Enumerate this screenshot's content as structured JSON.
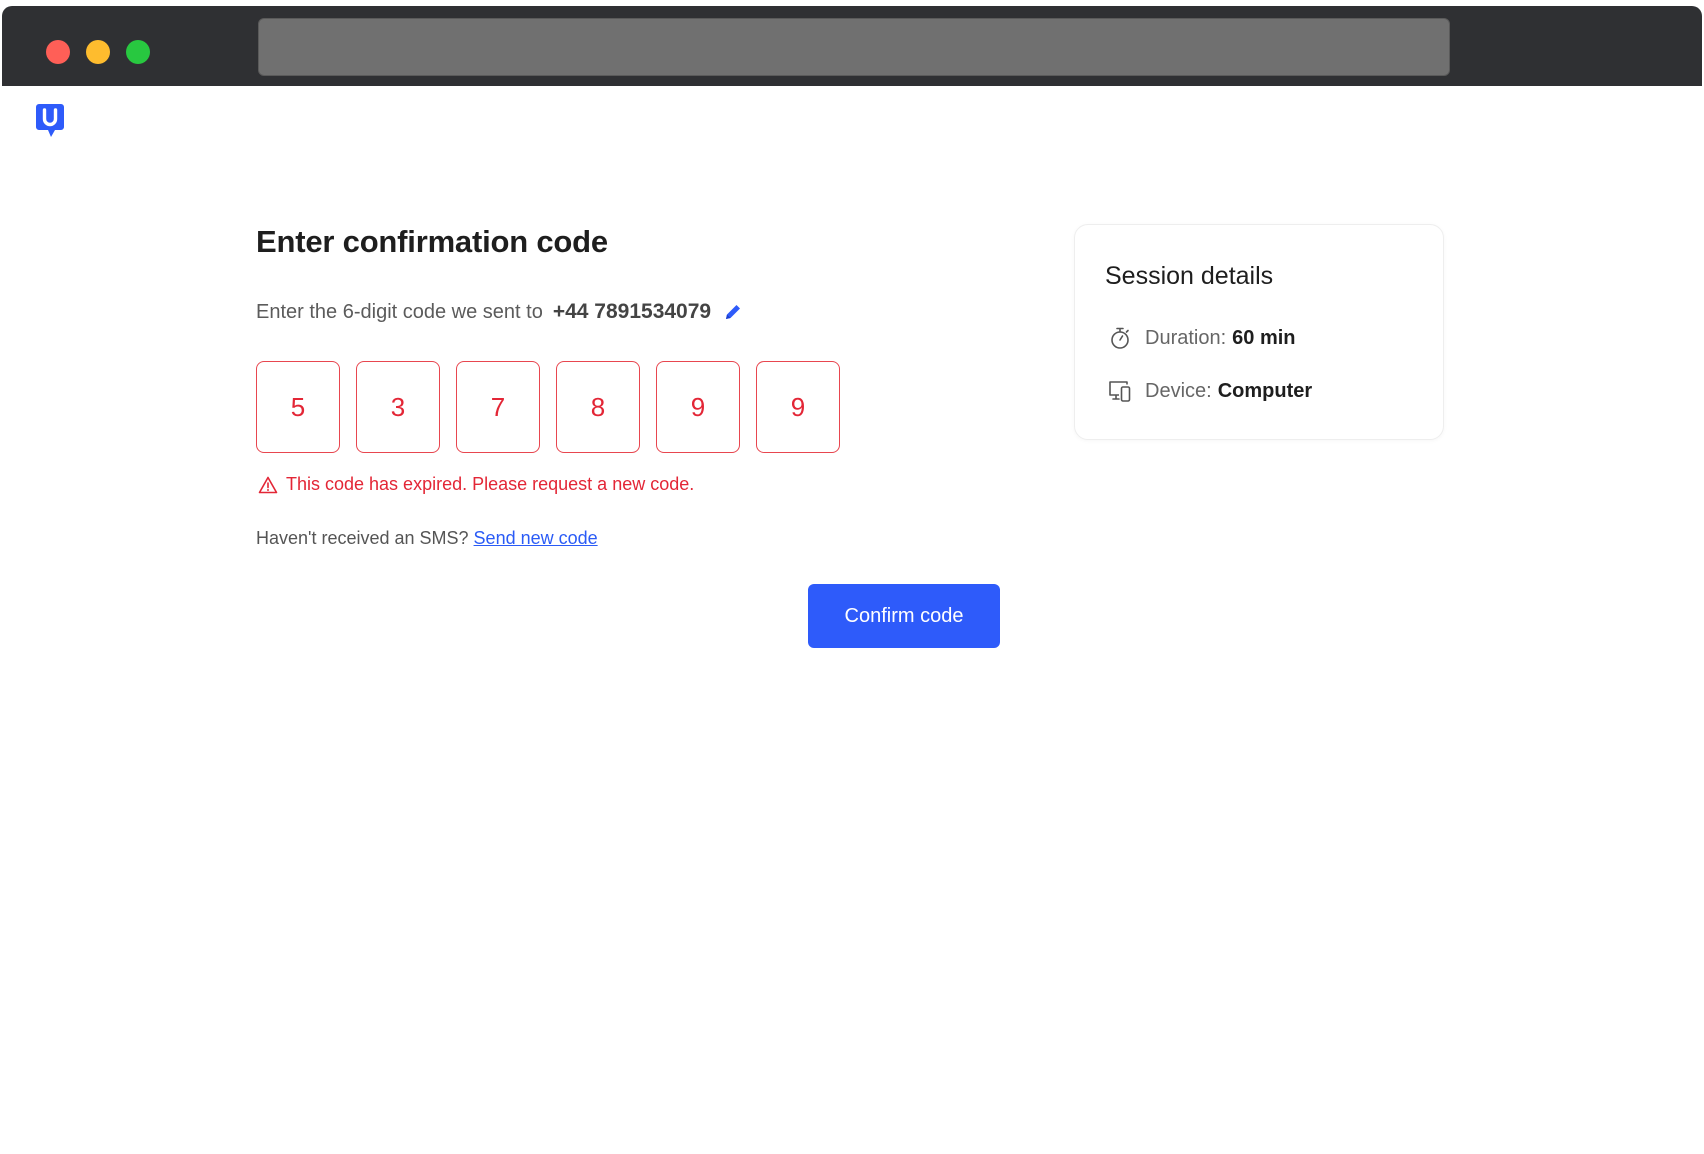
{
  "page": {
    "title": "Enter confirmation code",
    "instruction": "Enter the 6-digit code we sent to",
    "phone": "+44 7891534079",
    "code_digits": [
      "5",
      "3",
      "7",
      "8",
      "9",
      "9"
    ],
    "error_message": "This code has expired. Please request a new code.",
    "resend_prompt": "Haven't received an SMS?",
    "resend_link": "Send new code",
    "confirm_button": "Confirm code"
  },
  "session": {
    "title": "Session details",
    "duration_label": "Duration:",
    "duration_value": "60 min",
    "device_label": "Device:",
    "device_value": "Computer"
  },
  "icons": {
    "logo": "brand-logo",
    "edit": "pencil-icon",
    "warning": "warning-triangle-icon",
    "duration": "stopwatch-icon",
    "device": "devices-icon"
  },
  "colors": {
    "accent": "#2e5bfa",
    "error": "#e32636",
    "titlebar": "#2f3033"
  }
}
